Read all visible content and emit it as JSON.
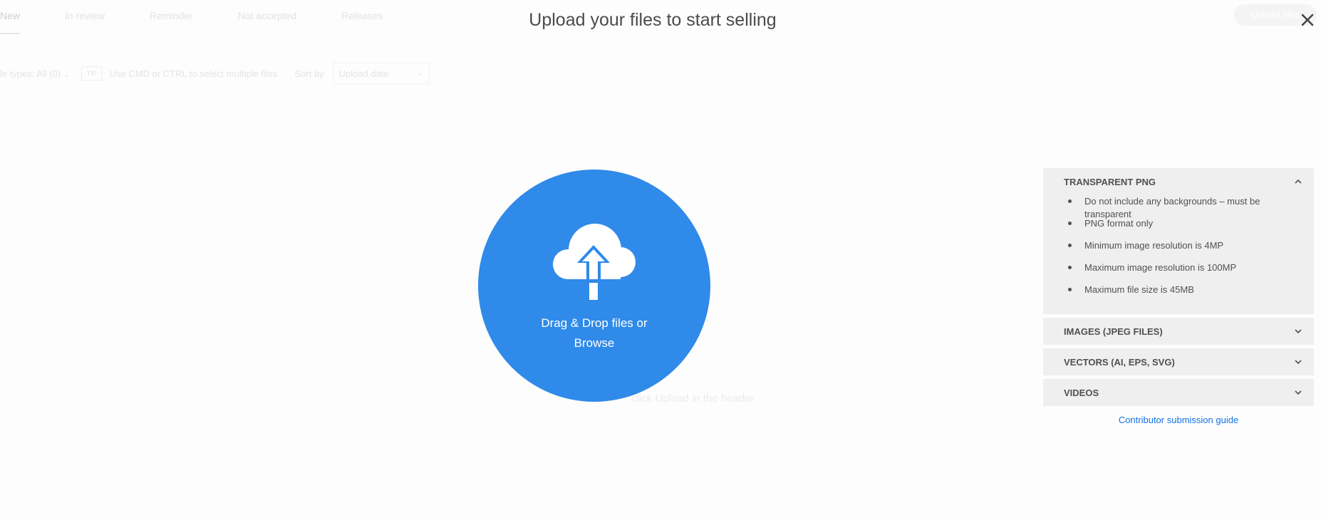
{
  "background": {
    "tabs": [
      {
        "label": "New"
      },
      {
        "label": "In review"
      },
      {
        "label": "Reminder"
      },
      {
        "label": "Not accepted"
      },
      {
        "label": "Releases"
      }
    ],
    "upload_button": "Upload files",
    "file_types": "le types: All (0)",
    "tip_badge": "TIP",
    "tip_text": "Use CMD or CTRL to select multiple files",
    "sort_by_label": "Sort by",
    "sort_value": "Upload date",
    "hint_text": "click Upload in the header"
  },
  "modal": {
    "title": "Upload your files to start selling",
    "drop_text_line1": "Drag & Drop files or",
    "drop_text_line2": "Browse",
    "accent_color": "#2f8ae9"
  },
  "accordion": {
    "sections": [
      {
        "title": "TRANSPARENT PNG",
        "expanded": true,
        "items": [
          "Do not include any backgrounds – must be transparent",
          "PNG format only",
          "Minimum image resolution is 4MP",
          "Maximum image resolution is 100MP",
          "Maximum file size is 45MB"
        ]
      },
      {
        "title": "IMAGES (JPEG FILES)",
        "expanded": false
      },
      {
        "title": "VECTORS (AI, EPS, SVG)",
        "expanded": false
      },
      {
        "title": "VIDEOS",
        "expanded": false
      }
    ],
    "guide_link": "Contributor submission guide"
  }
}
